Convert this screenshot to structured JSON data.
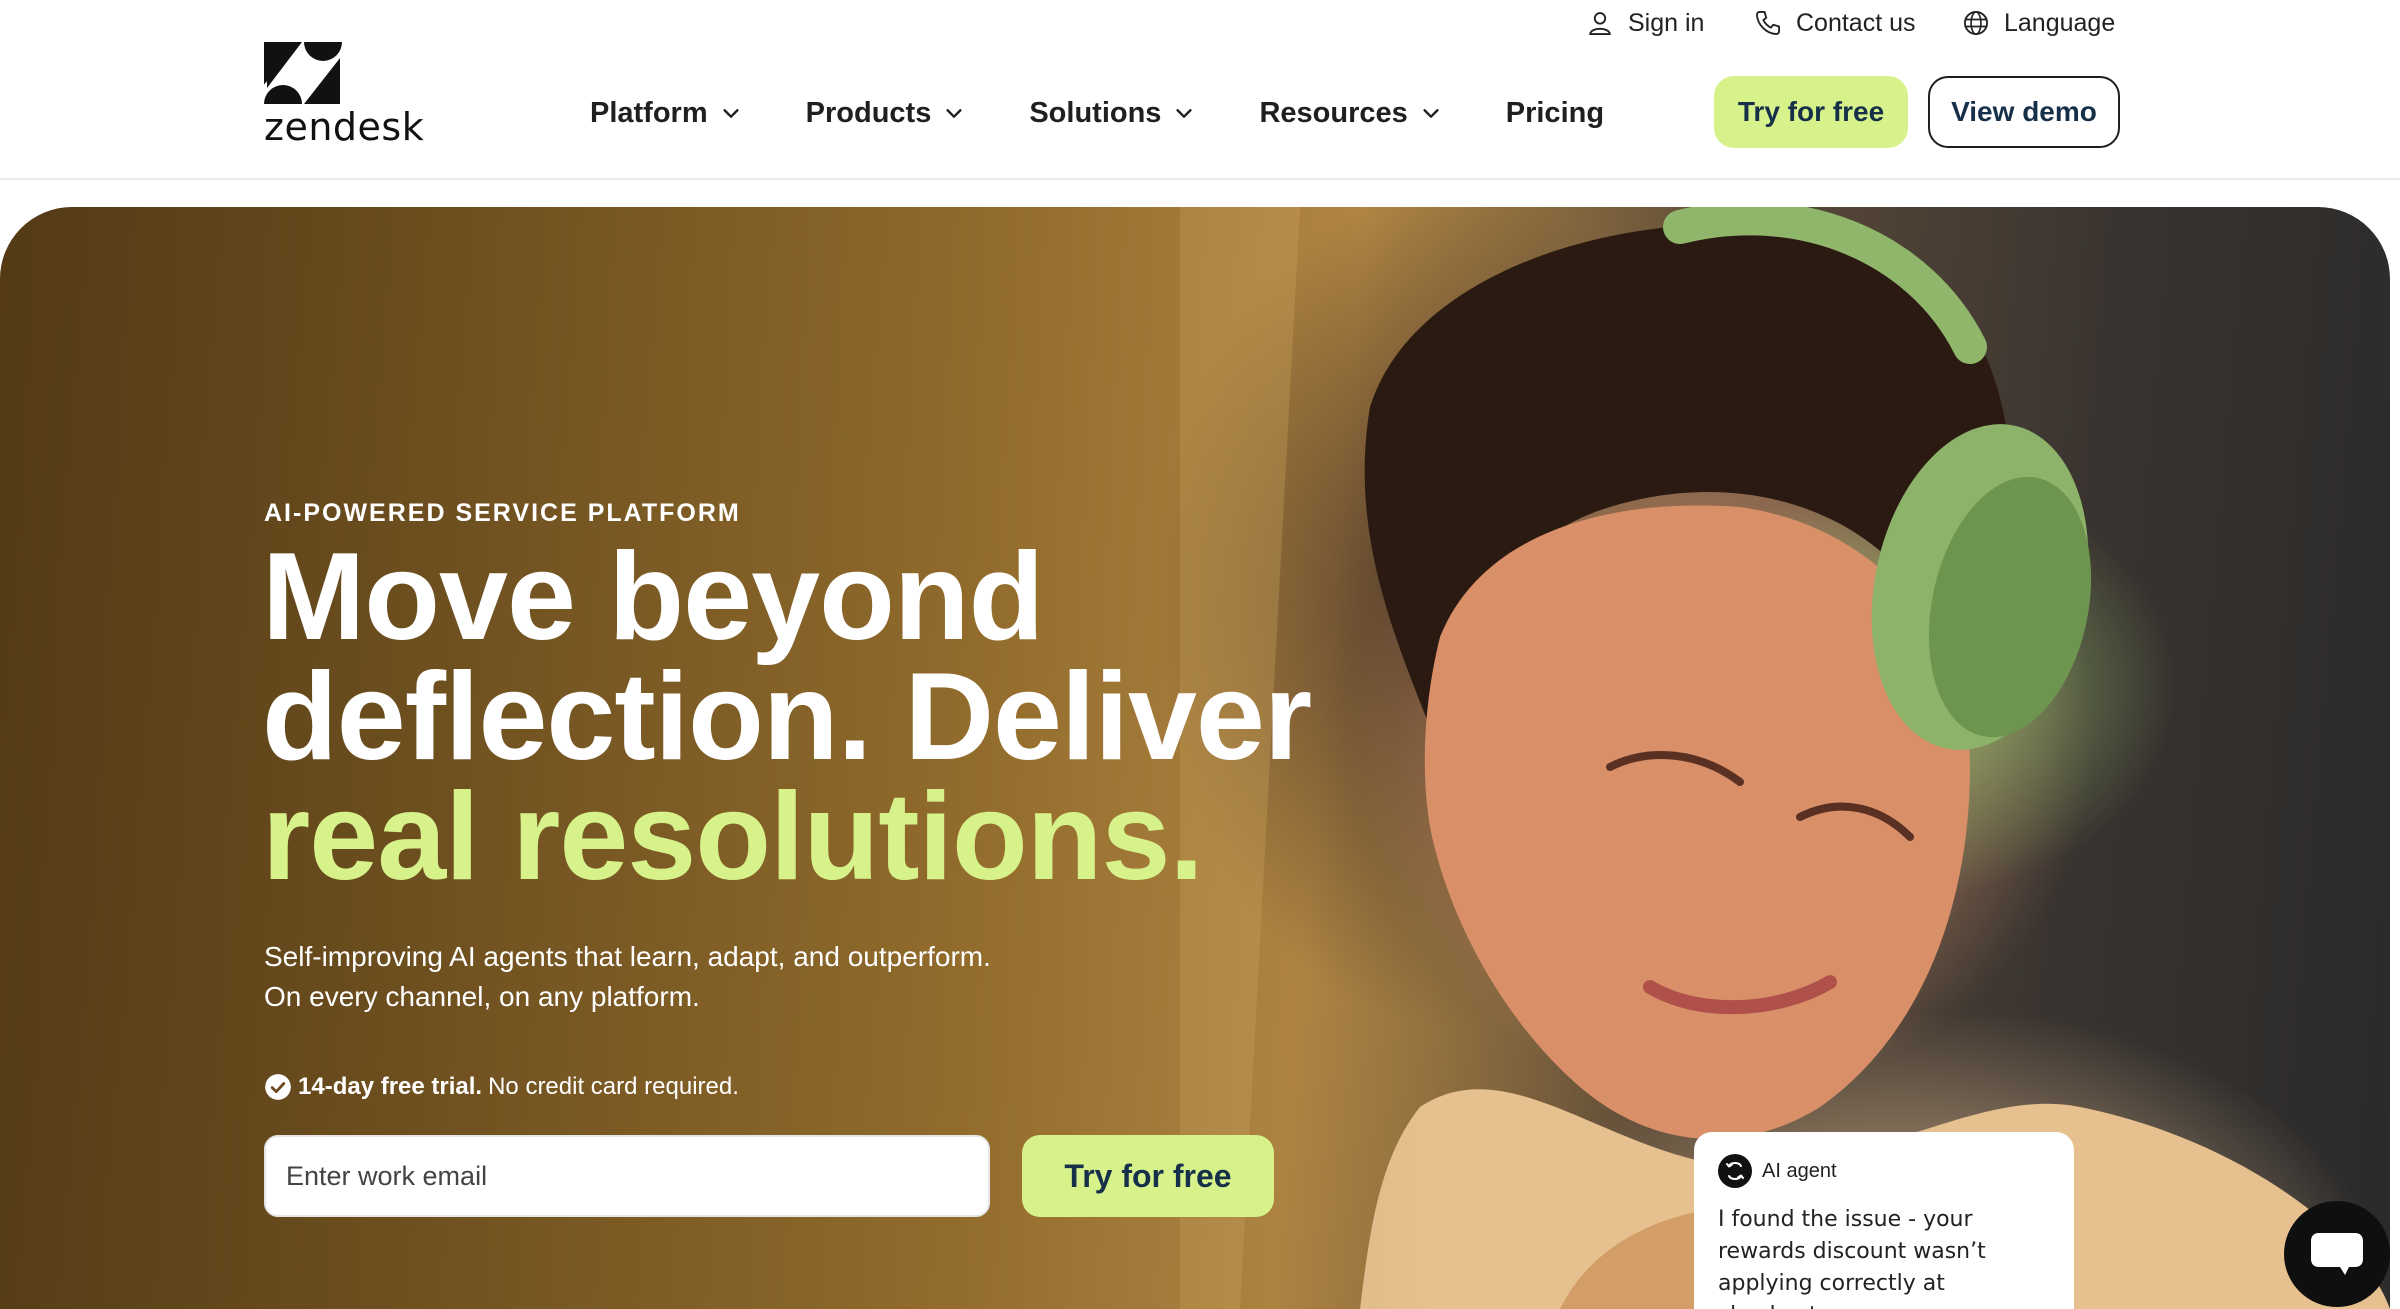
{
  "header": {
    "logo_text": "zendesk",
    "utility": {
      "signin": "Sign in",
      "contact": "Contact us",
      "language": "Language"
    },
    "nav": [
      {
        "label": "Platform",
        "has_dropdown": true
      },
      {
        "label": "Products",
        "has_dropdown": true
      },
      {
        "label": "Solutions",
        "has_dropdown": true
      },
      {
        "label": "Resources",
        "has_dropdown": true
      },
      {
        "label": "Pricing",
        "has_dropdown": false
      }
    ],
    "try_label": "Try for free",
    "demo_label": "View demo"
  },
  "hero": {
    "eyebrow": "AI-POWERED SERVICE PLATFORM",
    "headline_line1": "Move beyond",
    "headline_line2": "deflection. Deliver",
    "headline_line3": "real resolutions.",
    "subcopy_line1": "Self-improving AI agents that learn, adapt, and outperform.",
    "subcopy_line2": "On every channel, on any platform.",
    "trial_bold": "14-day free trial.",
    "trial_rest": "No credit card required.",
    "email_placeholder": "Enter work email",
    "cta_label": "Try for free"
  },
  "chat_card": {
    "title": "AI agent",
    "message": "I found the issue - your rewards discount wasn’t applying correctly at checkout."
  },
  "icons": {
    "signin": "user-icon",
    "contact": "phone-icon",
    "language": "globe-icon",
    "dropdown": "chevron-down-icon",
    "trial": "check-circle-icon",
    "chat_fab": "chat-bubble-icon"
  },
  "colors": {
    "accent_lime": "#d7f28a",
    "button_text": "#17304a",
    "dark": "#0f0f0f"
  }
}
